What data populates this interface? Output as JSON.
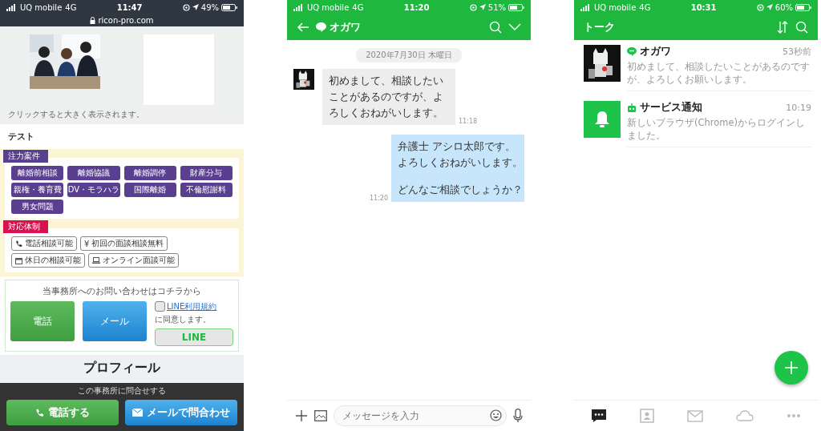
{
  "browser_screen": {
    "status": {
      "carrier": "UQ mobile",
      "network": "4G",
      "time": "11:47",
      "battery": "49%"
    },
    "url": "ricon-pro.com",
    "gallery": {
      "caption": "クリックすると大きく表示されます。"
    },
    "section_title": "テスト",
    "focus_cases": {
      "label": "注力案件",
      "tags": [
        "離婚前相談",
        "離婚協議",
        "離婚調停",
        "財産分与",
        "親権・養育費",
        "DV・モラハラ",
        "国際離婚",
        "不倫慰謝料",
        "男女問題"
      ]
    },
    "support": {
      "label": "対応体制",
      "items": [
        {
          "kind": "phone",
          "text": "電話相談可能"
        },
        {
          "kind": "yen",
          "symbol": "¥",
          "text": "初回の面談相談無料"
        },
        {
          "kind": "calendar",
          "text": "休日の相談可能"
        },
        {
          "kind": "laptop",
          "text": "オンライン面談可能"
        }
      ]
    },
    "contact": {
      "title": "当事務所へのお問い合わせはコチラから",
      "phone_button": "電話",
      "mail_button": "メール",
      "terms_checked": false,
      "terms_link": "LINE利用規約",
      "terms_text": "に同意します。",
      "line_button": "LINE"
    },
    "profile_heading": "プロフィール",
    "bottom_bar": {
      "title": "この事務所に問合せする",
      "call_button": "電話する",
      "mail_button": "メールで問合わせ"
    }
  },
  "chat_screen": {
    "status": {
      "carrier": "UQ mobile",
      "network": "4G",
      "time": "11:20",
      "battery": "51%"
    },
    "title": "オガワ",
    "date": "2020年7月30日 木曜日",
    "messages": [
      {
        "kind": "incoming",
        "text": "初めまして、相談したいことがあるのですが、よろしくおねがいします。",
        "time": "11:18"
      },
      {
        "kind": "outgoing",
        "paragraphs": [
          [
            "弁護士 アシロ太郎です。",
            "よろしくおねがいします。"
          ],
          [
            "どんなご相談でしょうか？"
          ]
        ],
        "time": "11:20"
      }
    ],
    "input": {
      "placeholder": "メッセージを入力"
    }
  },
  "talk_screen": {
    "status": {
      "carrier": "UQ mobile",
      "network": "4G",
      "time": "10:31",
      "battery": "60%"
    },
    "title": "トーク",
    "chats": [
      {
        "badge": {
          "kind": "line"
        },
        "name": "オガワ",
        "time": "53秒前",
        "preview": "初めまして、相談したいことがあるのですが、よろしくお願いします。"
      },
      {
        "avatar": {
          "kind": "bell"
        },
        "badge": {
          "kind": "bot"
        },
        "name": "サービス通知",
        "time": "10:19",
        "preview": "新しいブラウザ(Chrome)からログインしました。"
      }
    ],
    "tabs": [
      {
        "kind": "chat",
        "selected": true
      },
      {
        "kind": "contacts",
        "selected": false
      },
      {
        "kind": "mail",
        "selected": false
      },
      {
        "kind": "cloud",
        "selected": false
      },
      {
        "kind": "more",
        "selected": false
      }
    ]
  }
}
